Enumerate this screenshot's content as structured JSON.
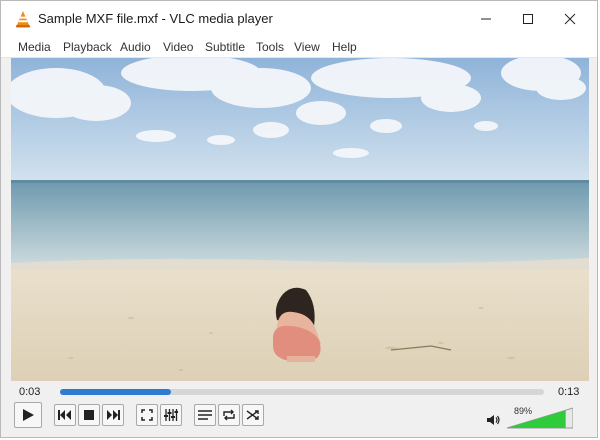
{
  "window": {
    "title": "Sample MXF file.mxf - VLC media player"
  },
  "menu": [
    "Media",
    "Playback",
    "Audio",
    "Video",
    "Subtitle",
    "Tools",
    "View",
    "Help"
  ],
  "playback": {
    "elapsed": "0:03",
    "total": "0:13",
    "progress": 0.23
  },
  "volume": {
    "label": "89%",
    "level": 0.89
  },
  "colors": {
    "accent": "#2f7bd4",
    "volume_green": "#2ecc3a",
    "vlc_orange": "#f28a14"
  },
  "icons": {
    "play": "play-icon",
    "previous": "previous-icon",
    "stop": "stop-icon",
    "next": "next-icon",
    "fullscreen": "fullscreen-icon",
    "extended_settings": "equalizer-icon",
    "playlist": "playlist-icon",
    "loop": "loop-icon",
    "shuffle": "shuffle-icon",
    "speaker": "speaker-icon"
  }
}
